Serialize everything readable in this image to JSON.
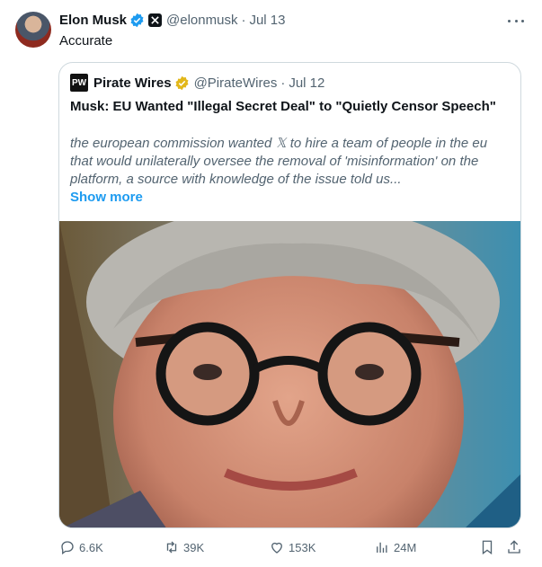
{
  "tweet": {
    "author_name": "Elon Musk",
    "handle": "@elonmusk",
    "separator": "·",
    "date": "Jul 13",
    "text": "Accurate"
  },
  "quoted": {
    "logo_text": "PW",
    "author_name": "Pirate Wires",
    "handle": "@PirateWires",
    "separator": "·",
    "date": "Jul 12",
    "title": "Musk: EU Wanted \"Illegal Secret Deal\" to \"Quietly Censor Speech\"",
    "body": "the european commission wanted 𝕏 to hire a team of people in the eu that would unilaterally oversee the removal of 'misinformation' on the platform, a source with knowledge of the issue told us...",
    "show_more": "Show more"
  },
  "actions": {
    "replies": "6.6K",
    "reposts": "39K",
    "likes": "153K",
    "views": "24M"
  },
  "icons": [
    "verified-badge-icon",
    "x-affiliate-icon",
    "more-icon",
    "gold-badge-icon",
    "reply-icon",
    "repost-icon",
    "like-icon",
    "views-icon",
    "bookmark-icon",
    "share-icon"
  ],
  "colors": {
    "accent": "#1d9bf0",
    "muted": "#536471",
    "gold": "#e2b719"
  }
}
